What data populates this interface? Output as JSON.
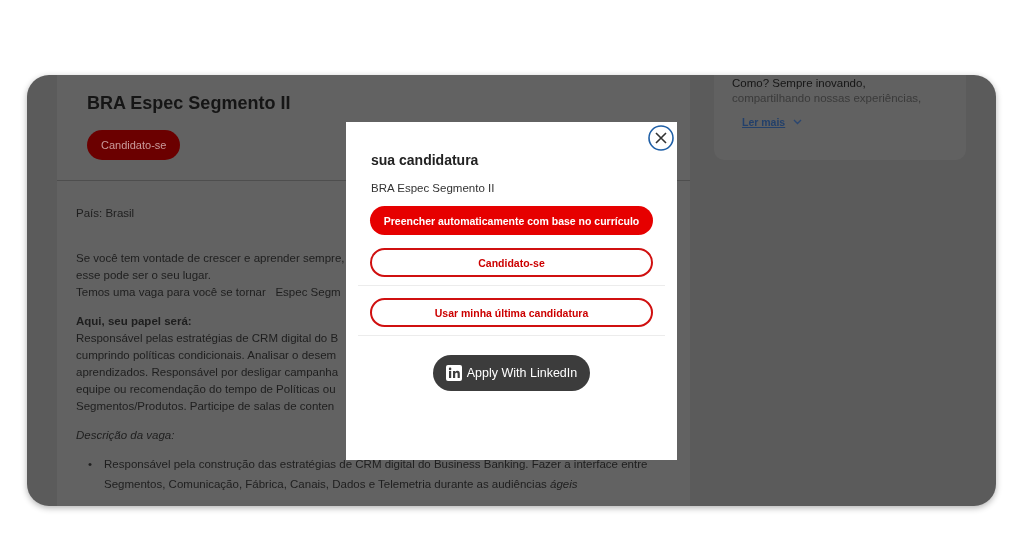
{
  "job_page": {
    "title": "BRA Espec Segmento II",
    "apply_button": "Candidato-se",
    "country": "País: Brasil",
    "intro_lines": [
      "Se você tem vontade de crescer e aprender sempre,",
      "esse pode ser o seu lugar.",
      "Temos uma vaga para você se tornar   Espec Segm"
    ],
    "role_heading": "Aqui, seu papel será:",
    "role_lines": [
      "Responsável pelas estratégias de CRM digital do B",
      "cumprindo políticas condicionais. Analisar o desem",
      "aprendizados. Responsável por desligar campanha",
      "equipe ou recomendação do tempo de Políticas ou",
      "Segmentos/Produtos. Participe de salas de conten"
    ],
    "description_heading": "Descrição da vaga:",
    "bullets": [
      {
        "marker": "•",
        "text": "Responsável pela construção das estratégias de CRM digital do Business Banking. Fazer a interface entre Segmentos, Comunicação, Fábrica, Canais, Dados e Telemetria durante as audiências *ágeis*"
      }
    ]
  },
  "side_card": {
    "lines": [
      "Como? Sempre inovando,",
      "compartilhando nossas experiências,"
    ],
    "read_more": "Ler mais"
  },
  "modal": {
    "title": "sua candidatura",
    "subtitle": "BRA Espec Segmento II",
    "option_groups": [
      [
        {
          "label": "Preencher automaticamente com base no currículo",
          "kind": "filled"
        },
        {
          "label": "Candidato-se",
          "kind": "outline"
        }
      ],
      [
        {
          "label": "Usar minha última candidatura",
          "kind": "outline"
        }
      ]
    ],
    "linkedin_button": "Apply With LinkedIn"
  }
}
